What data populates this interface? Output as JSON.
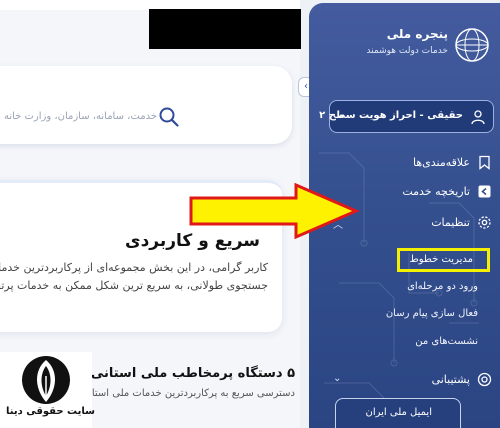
{
  "brand": {
    "title": "پنجره ملی",
    "subtitle": "خدمات دولت هوشمند"
  },
  "search": {
    "placeholder": "خدمت، سامانه، سازمان، وزارت خانه م"
  },
  "hero_card": {
    "title": "سریع و کاربردی",
    "line1": "کاربر گرامی، در این بخش مجموعه‌ای از پرکاربردترین خدمات",
    "line2": "جستجوی طولانی، به سریع ترین شکل ممکن به خدمات پرتقا"
  },
  "section2": {
    "title": "۵ دستگاه پرمخاطب ملی استانی",
    "subtitle": "دسترسی سریع به پرکاربردترین خدمات ملی استانی"
  },
  "watermark": {
    "text": "سایت حقوقی دینا"
  },
  "toggle": {
    "icon": "‹›"
  },
  "user": {
    "label": "حقیقی - احراز هویت سطح ۲"
  },
  "sidebar": {
    "items": [
      {
        "label": "علاقه‌مندی‌ها",
        "icon": "bookmark-icon"
      },
      {
        "label": "تاریخچه خدمت",
        "icon": "history-icon"
      },
      {
        "label": "تنظیمات",
        "icon": "gear-icon"
      }
    ],
    "settings_sub": [
      {
        "label": "مدیریت خطوط"
      },
      {
        "label": "ورود دو مرحله‌ای"
      },
      {
        "label": "فعال سازی پیام رسان"
      },
      {
        "label": "نشست‌های من"
      }
    ],
    "support": {
      "label": "پشتیبانی",
      "icon": "support-icon"
    },
    "email_card": {
      "label": "ایمیل ملی ایران"
    }
  },
  "colors": {
    "sidebar": "#35508f",
    "highlight": "#f5f000",
    "arrow_fill": "#fff200",
    "arrow_stroke": "#e01818"
  }
}
